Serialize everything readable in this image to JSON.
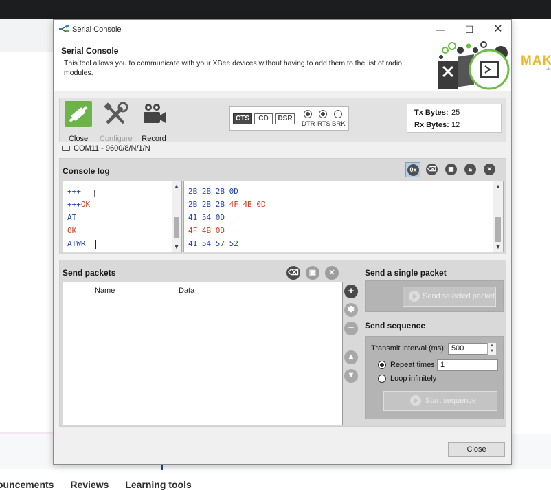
{
  "background": {
    "logo_text": "MAK",
    "logo_sub": "LE",
    "tabs": [
      "ouncements",
      "Reviews",
      "Learning tools"
    ]
  },
  "window": {
    "title": "Serial Console",
    "controls": {
      "minimize": "—",
      "maximize": "☐",
      "close": "✕"
    }
  },
  "header": {
    "title": "Serial Console",
    "description": "This tool allows you to communicate with your XBee devices without having to add them to the list of radio modules."
  },
  "toolbar": {
    "close_label": "Close",
    "configure_label": "Configure",
    "record_label": "Record",
    "lines": {
      "cts": "CTS",
      "cd": "CD",
      "dsr": "DSR",
      "dtr": "DTR",
      "rts": "RTS",
      "brk": "BRK"
    },
    "line_states": {
      "cts": true,
      "cd": false,
      "dsr": false,
      "dtr": true,
      "rts": true,
      "brk": false
    },
    "tx_label": "Tx Bytes:",
    "tx_value": "25",
    "rx_label": "Rx Bytes:",
    "rx_value": "12"
  },
  "port": {
    "text": "COM11 - 9600/8/N/1/N"
  },
  "console": {
    "title": "Console log",
    "hex_toggle": "0x",
    "ascii": [
      {
        "parts": [
          {
            "text": "+++",
            "dir": "tx"
          }
        ]
      },
      {
        "parts": [
          {
            "text": "+++",
            "dir": "tx"
          },
          {
            "text": "OK",
            "dir": "rx"
          }
        ]
      },
      {
        "parts": [
          {
            "text": "AT",
            "dir": "tx"
          }
        ]
      },
      {
        "parts": [
          {
            "text": "OK",
            "dir": "rx"
          }
        ]
      },
      {
        "parts": [
          {
            "text": "ATWR",
            "dir": "tx"
          }
        ]
      }
    ],
    "hex": [
      {
        "parts": [
          {
            "text": "2B 2B 2B 0D",
            "dir": "tx"
          }
        ]
      },
      {
        "parts": [
          {
            "text": "2B 2B 2B ",
            "dir": "tx"
          },
          {
            "text": "4F 4B 0D",
            "dir": "rx"
          }
        ]
      },
      {
        "parts": [
          {
            "text": "41 54 0D",
            "dir": "tx"
          }
        ]
      },
      {
        "parts": [
          {
            "text": "4F 4B 0D",
            "dir": "rx"
          }
        ]
      },
      {
        "parts": [
          {
            "text": "41 54 57 52",
            "dir": "tx"
          }
        ]
      }
    ],
    "colors": {
      "tx": "#2244bb",
      "rx": "#d23b1c"
    }
  },
  "send_packets": {
    "title": "Send packets",
    "columns": {
      "name": "Name",
      "data": "Data"
    }
  },
  "single_packet": {
    "title": "Send a single packet",
    "button": "Send selected packet"
  },
  "sequence": {
    "title": "Send sequence",
    "interval_label": "Transmit interval (ms):",
    "interval_value": "500",
    "repeat_label": "Repeat times",
    "repeat_value": "1",
    "loop_label": "Loop infinitely",
    "selected_mode": "repeat",
    "start_button": "Start sequence"
  },
  "footer": {
    "close_label": "Close"
  }
}
